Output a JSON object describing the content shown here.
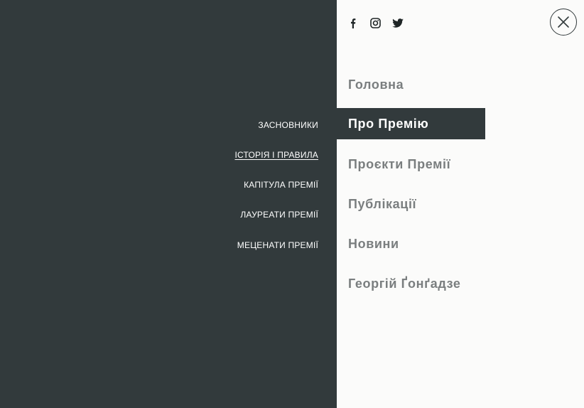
{
  "submenu": {
    "items": [
      {
        "label": "ЗАСНОВНИКИ",
        "active": false
      },
      {
        "label": "ІСТОРІЯ І ПРАВИЛА",
        "active": true
      },
      {
        "label": "КАПІТУЛА ПРЕМІЇ",
        "active": false
      },
      {
        "label": "ЛАУРЕАТИ ПРЕМІЇ",
        "active": false
      },
      {
        "label": "МЕЦЕНАТИ ПРЕМІЇ",
        "active": false
      }
    ]
  },
  "social": {
    "icons": [
      "facebook-icon",
      "instagram-icon",
      "twitter-icon"
    ]
  },
  "close": {
    "icon": "close-icon"
  },
  "main_menu": {
    "items": [
      {
        "label": "Головна",
        "active": false
      },
      {
        "label": "Про Премію",
        "active": true
      },
      {
        "label": "Проєкти Премії",
        "active": false
      },
      {
        "label": "Публікації",
        "active": false
      },
      {
        "label": "Новини",
        "active": false
      },
      {
        "label": "Георгій Ґонґадзе",
        "active": false
      }
    ]
  },
  "colors": {
    "dark_panel": "#323a3c",
    "light_panel": "#fbfbfa",
    "menu_text": "#7a7e7f",
    "active_text": "#ffffff"
  }
}
